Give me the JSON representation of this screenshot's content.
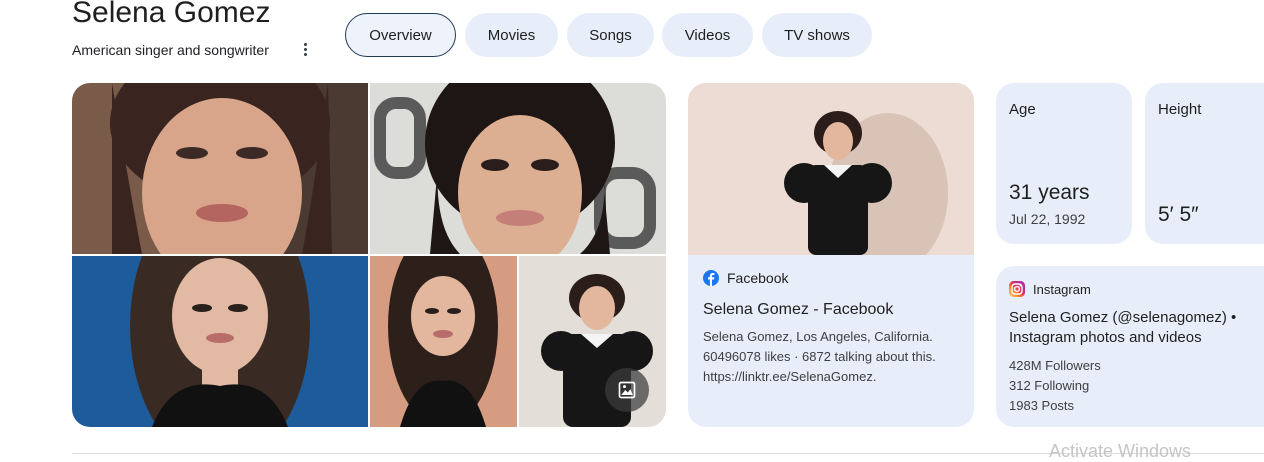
{
  "entity": {
    "name": "Selena Gomez",
    "description": "American singer and songwriter"
  },
  "tabs": [
    {
      "label": "Overview",
      "active": true
    },
    {
      "label": "Movies",
      "active": false
    },
    {
      "label": "Songs",
      "active": false
    },
    {
      "label": "Videos",
      "active": false
    },
    {
      "label": "TV shows",
      "active": false
    }
  ],
  "image_grid": {
    "more_images_icon": "image-icon"
  },
  "facebook_card": {
    "source": "Facebook",
    "source_icon": "facebook-icon",
    "title": "Selena Gomez - Facebook",
    "snippet_lines": [
      "Selena Gomez, Los Angeles, California.",
      "60496078 likes · 6872 talking about this.",
      "https://linktr.ee/SelenaGomez."
    ]
  },
  "facts": {
    "age": {
      "label": "Age",
      "value": "31 years",
      "detail": "Jul 22, 1992"
    },
    "height": {
      "label": "Height",
      "value": "5′ 5″"
    }
  },
  "instagram_card": {
    "source": "Instagram",
    "source_icon": "instagram-icon",
    "title_lines": [
      "Selena Gomez (@selenagomez) •",
      "Instagram photos and videos"
    ],
    "stats": [
      "428M Followers",
      "312 Following",
      "1983 Posts"
    ]
  },
  "os_watermark": "Activate Windows",
  "colors": {
    "chip_bg": "#e8eef9",
    "chip_active_border": "#1f3b57",
    "card_bg": "#e8eef9",
    "facebook_blue": "#1877f2"
  }
}
